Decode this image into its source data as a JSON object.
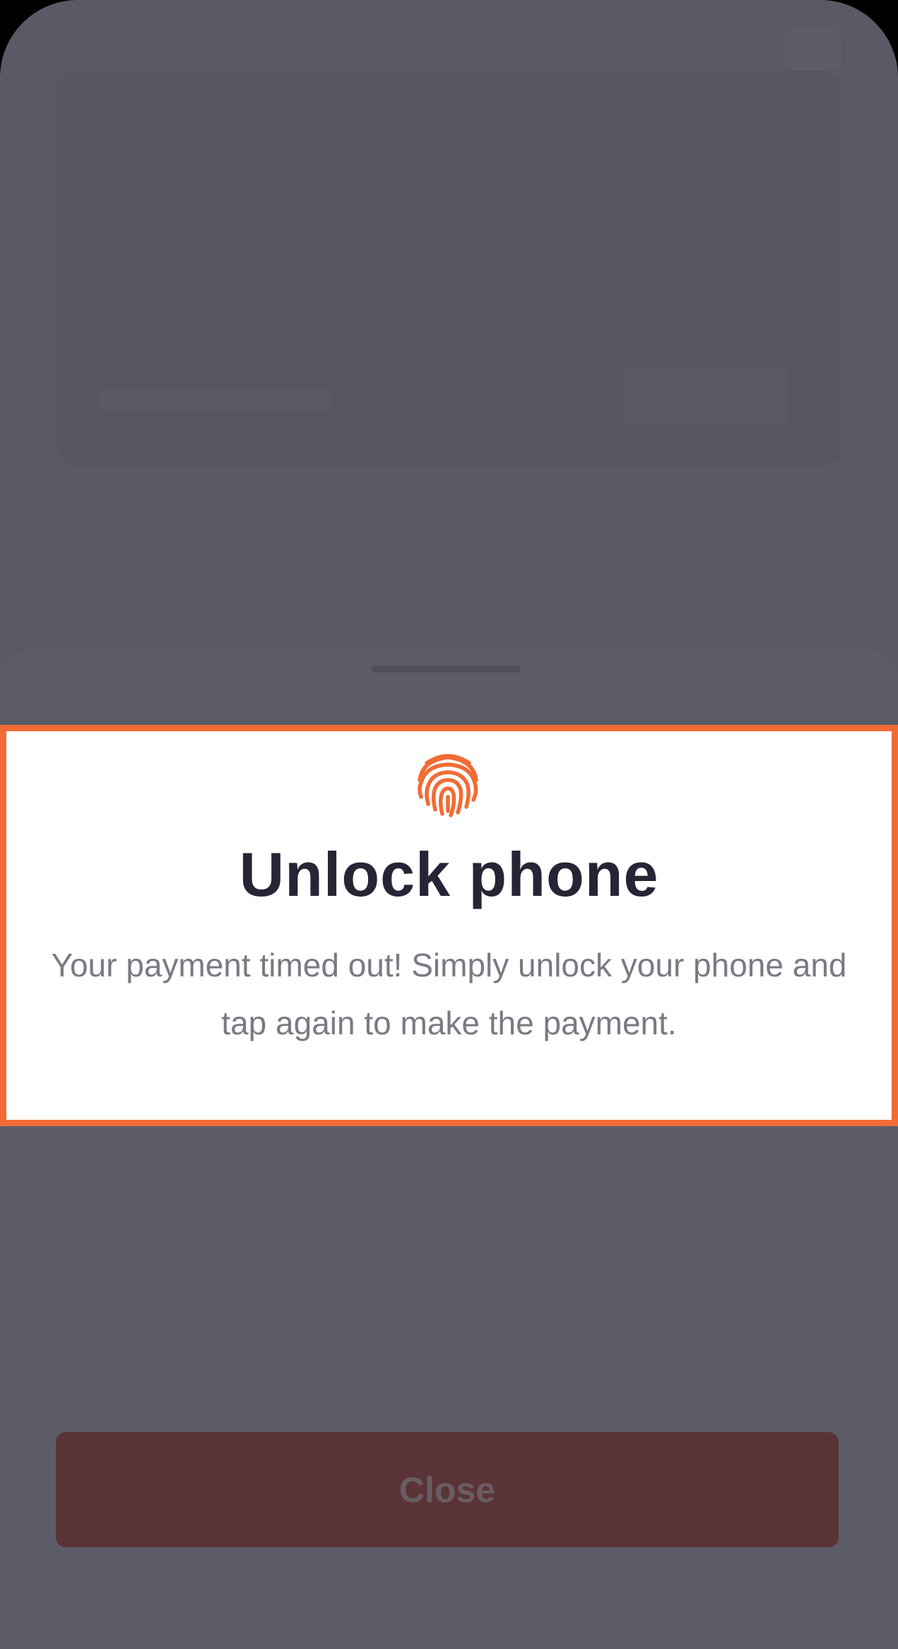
{
  "dialog": {
    "icon": "fingerprint-icon",
    "title": "Unlock phone",
    "message": "Your payment timed out! Simply unlock your phone and tap again to make the payment."
  },
  "footer": {
    "close_label": "Close"
  },
  "colors": {
    "accent": "#f26b34",
    "title_text": "#252535",
    "body_text": "#7a7a84",
    "overlay": "#5a5a66",
    "close_button_bg": "#5a3436"
  }
}
